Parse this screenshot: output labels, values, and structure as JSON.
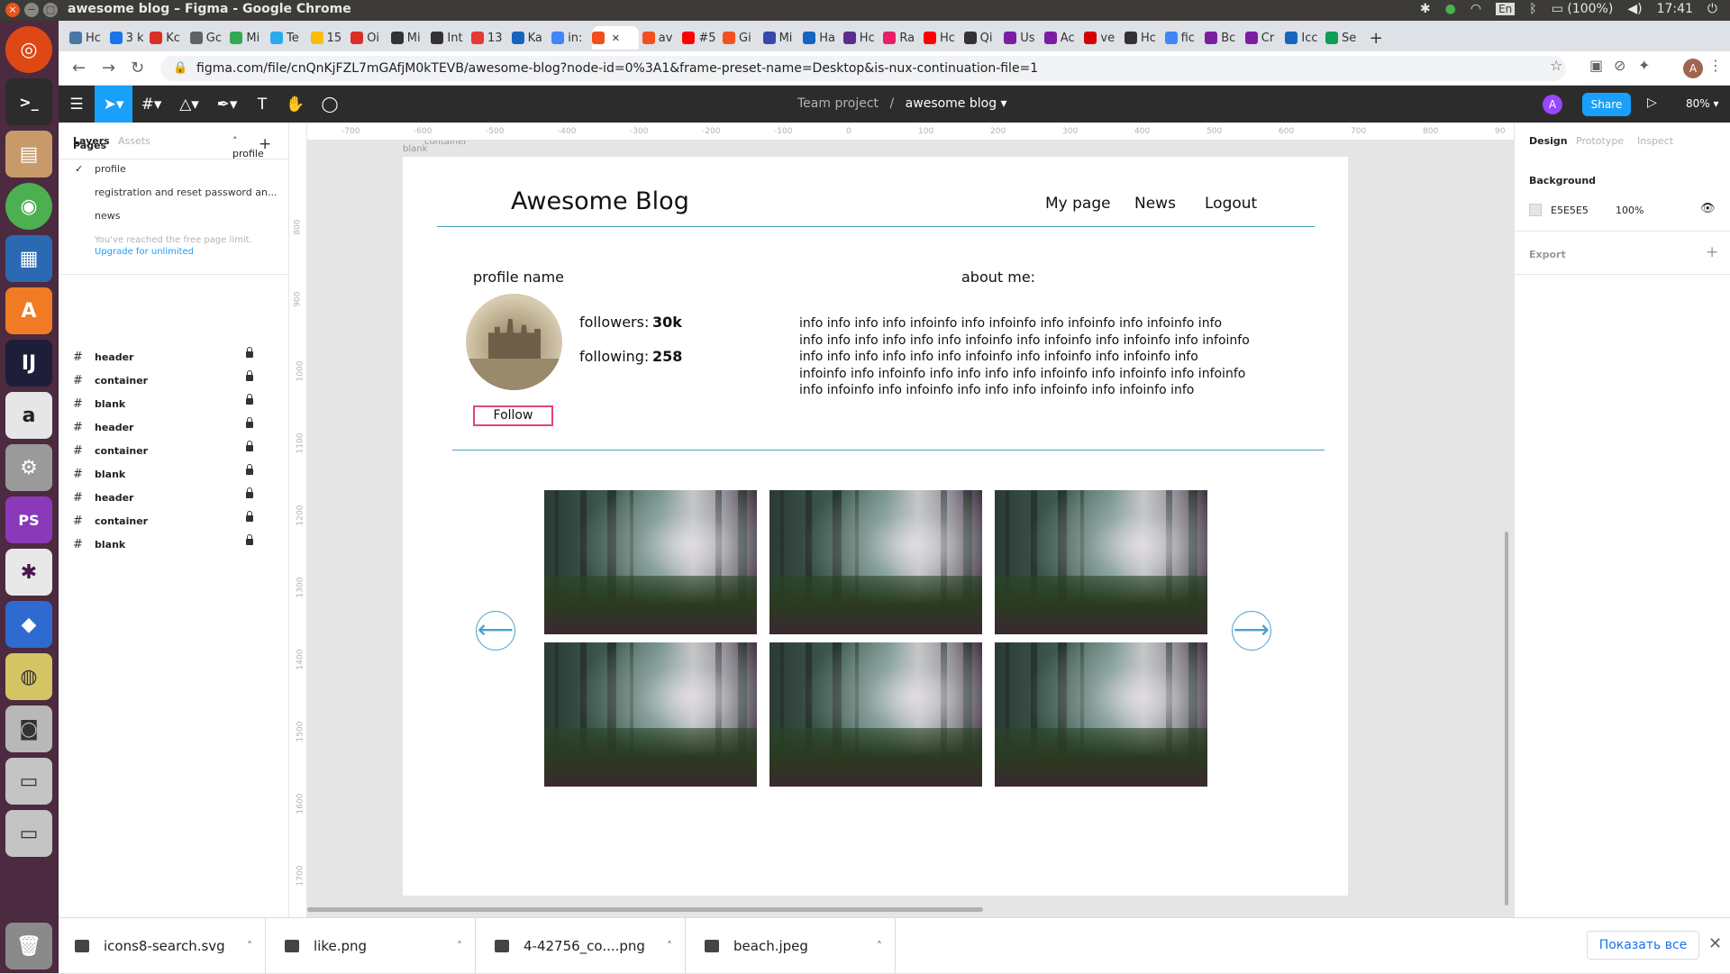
{
  "window_title": "awesome blog – Figma - Google Chrome",
  "system_tray": {
    "lang": "En",
    "battery": "(100%)",
    "clock": "17:41"
  },
  "tabs": [
    "Hc",
    "3 k",
    "Kc",
    "Gc",
    "Mi",
    "Te",
    "15",
    "Oi",
    "Mi",
    "Int",
    "13",
    "Ka",
    "in:",
    "",
    "av",
    "#5",
    "Gi",
    "Mi",
    "Ha",
    "Hc",
    "Ra",
    "Hc",
    "Qi",
    "Us",
    "Ac",
    "ve",
    "Hc",
    "fic",
    "Bc",
    "Cr",
    "Icc",
    "Se"
  ],
  "url": "figma.com/file/cnQnKjFZL7mGAfjM0kTEVB/awesome-blog?node-id=0%3A1&frame-preset-name=Desktop&is-nux-continuation-file=1",
  "figma": {
    "breadcrumb_team": "Team project",
    "breadcrumb_sep": "/",
    "file_name": "awesome blog",
    "user_initial": "A",
    "share_label": "Share",
    "zoom": "80%",
    "left_tabs": {
      "layers": "Layers",
      "assets": "Assets",
      "page": "profile"
    },
    "pages_title": "Pages",
    "pages": [
      "profile",
      "registration and reset password an...",
      "news"
    ],
    "page_limit_note": "You've reached the free page limit.",
    "upgrade_link": "Upgrade for unlimited",
    "layers": [
      "header",
      "container",
      "blank",
      "header",
      "container",
      "blank",
      "header",
      "container",
      "blank"
    ],
    "right_tabs": {
      "design": "Design",
      "prototype": "Prototype",
      "inspect": "Inspect"
    },
    "background_label": "Background",
    "background_hex": "E5E5E5",
    "background_opacity": "100%",
    "export_label": "Export",
    "ruler_h": [
      "-700",
      "-600",
      "-500",
      "-400",
      "-300",
      "-200",
      "-100",
      "0",
      "100",
      "200",
      "300",
      "400",
      "500",
      "600",
      "700",
      "800",
      "90"
    ],
    "ruler_v": [
      "800",
      "900",
      "1000",
      "1100",
      "1200",
      "1300",
      "1400",
      "1500",
      "1600",
      "1700"
    ],
    "frame_labels": {
      "blank": "blank",
      "container": "container",
      "header": "header"
    }
  },
  "design": {
    "blog_title": "Awesome Blog",
    "nav": [
      "My page",
      "News",
      "Logout"
    ],
    "profile_name": "profile name",
    "followers_label": "followers:",
    "followers_value": "30k",
    "following_label": "following:",
    "following_value": "258",
    "follow_button": "Follow",
    "about_label": "about me:",
    "about_lines": [
      "info info info info infoinfo info infoinfo info infoinfo info infoinfo info",
      "info info info info info info infoinfo info infoinfo info infoinfo info infoinfo",
      "info info info info info info infoinfo info infoinfo info infoinfo info",
      "infoinfo info infoinfo info info info info infoinfo info infoinfo info infoinfo",
      "info infoinfo info infoinfo info info info infoinfo info infoinfo info"
    ],
    "arrow_left": "⟵",
    "arrow_right": "⟶"
  },
  "downloads": [
    {
      "name": "icons8-search.svg"
    },
    {
      "name": "like.png"
    },
    {
      "name": "4-42756_co....png"
    },
    {
      "name": "beach.jpeg"
    }
  ],
  "downloads_show_all": "Показать все"
}
